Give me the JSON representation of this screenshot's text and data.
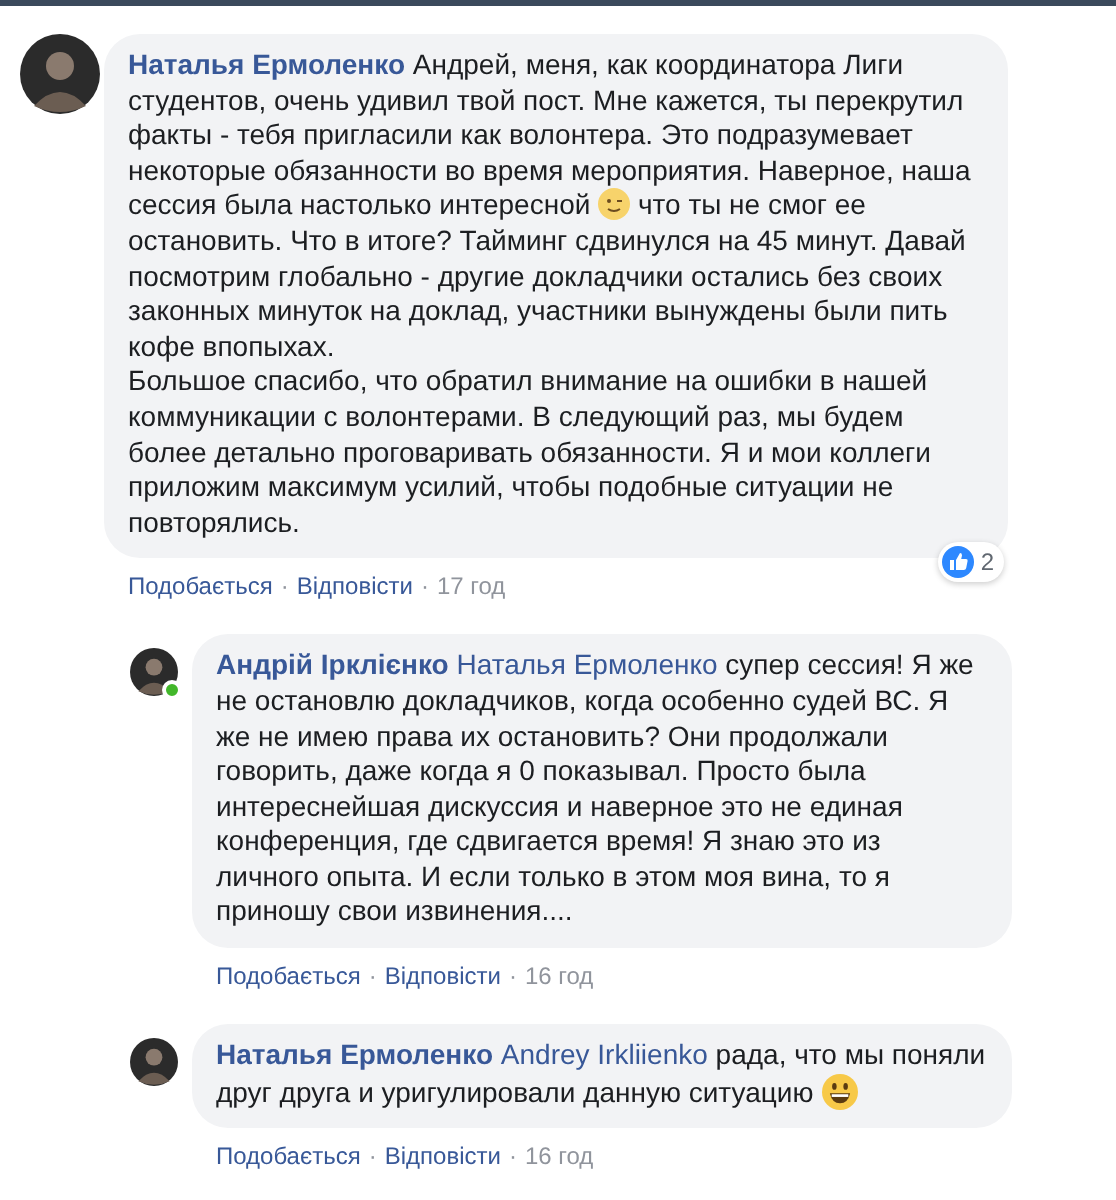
{
  "comments": [
    {
      "author": "Наталья Ермоленко",
      "online": false,
      "segments": [
        {
          "kind": "text",
          "text": " Андрей, меня, как координатора Лиги студентов, очень удивил твой пост. Мне кажется, ты перекрутил факты - тебя пригласили как волонтера. Это подразумевает некоторые обязанности во время мероприятия. Наверное, наша сессия была настолько интересной "
        },
        {
          "kind": "wink_emoji"
        },
        {
          "kind": "text",
          "text": " что ты не смог ее остановить. Что в итоге? Тайминг сдвинулся на 45 минут. Давай посмотрим глобально - другие докладчики остались без своих законных минуток на доклад, участники вынуждены были пить кофе впопыхах.\nБольшое спасибо, что обратил внимание на ошибки в нашей коммуникации с волонтерами. В следующий раз, мы будем более детально проговаривать обязанности. Я и мои коллеги приложим максимум усилий, чтобы подобные ситуации не повторялись."
        }
      ],
      "reactions": "2",
      "actions": [
        "Подобається",
        "·",
        "Відповісти",
        "·"
      ],
      "time": "17 год",
      "replies": [
        {
          "author": "Андрій Ірклієнко",
          "online": true,
          "mention": "Наталья Ермоленко",
          "segments": [
            {
              "kind": "text",
              "text": " супер сессия! Я же не остановлю докладчиков, когда особенно судей ВС. Я же не имею права их остановить? Они продолжали говорить, даже когда я 0 показывал. Просто была интереснейшая дискуссия и наверное это не единая конференция, где сдвигается время! Я знаю это из личного опыта. И если только в этом моя вина, то я приношу свои извинения...."
            }
          ],
          "actions": [
            "Подобається",
            "·",
            "Відповісти",
            "·"
          ],
          "time": "16 год"
        },
        {
          "author": "Наталья Ермоленко",
          "online": false,
          "mention": "Andrey Irkliienko",
          "segments": [
            {
              "kind": "text",
              "text": " рада, что мы поняли друг друга и уригулировали данную ситуацию "
            },
            {
              "kind": "grin_emoji"
            }
          ],
          "actions": [
            "Подобається",
            "·",
            "Відповісти",
            "·"
          ],
          "time": "16 год"
        }
      ]
    }
  ]
}
